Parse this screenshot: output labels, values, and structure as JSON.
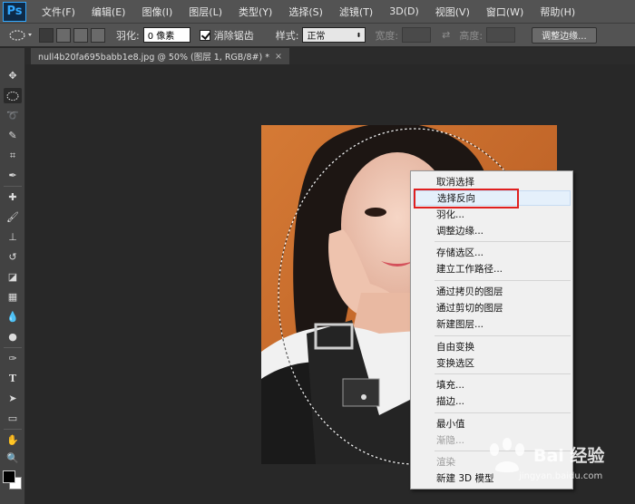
{
  "app": {
    "logo": "Ps"
  },
  "menu": [
    "文件(F)",
    "编辑(E)",
    "图像(I)",
    "图层(L)",
    "类型(Y)",
    "选择(S)",
    "滤镜(T)",
    "3D(D)",
    "视图(V)",
    "窗口(W)",
    "帮助(H)"
  ],
  "options": {
    "feather_label": "羽化:",
    "feather_value": "0 像素",
    "antialias_label": "消除锯齿",
    "style_label": "样式:",
    "style_value": "正常",
    "width_label": "宽度:",
    "height_label": "高度:",
    "refine_button": "调整边缘..."
  },
  "document_tab": {
    "title": "null4b20fa695babb1e8.jpg @ 50% (图层 1, RGB/8#) *",
    "close": "×"
  },
  "tools": [
    "move-tool",
    "elliptical-marquee-tool",
    "lasso-tool",
    "quick-selection-tool",
    "crop-tool",
    "eyedropper-tool",
    "healing-brush-tool",
    "brush-tool",
    "clone-stamp-tool",
    "history-brush-tool",
    "eraser-tool",
    "gradient-tool",
    "blur-tool",
    "dodge-tool",
    "pen-tool",
    "type-tool",
    "path-selection-tool",
    "rectangle-tool",
    "hand-tool",
    "zoom-tool"
  ],
  "context_menu": {
    "items": [
      {
        "label": "取消选择",
        "disabled": false
      },
      {
        "label": "选择反向",
        "disabled": false,
        "hover": true
      },
      {
        "label": "羽化...",
        "disabled": false
      },
      {
        "label": "调整边缘...",
        "disabled": false
      },
      {
        "label": "存储选区...",
        "disabled": false
      },
      {
        "label": "建立工作路径...",
        "disabled": false
      },
      {
        "label": "通过拷贝的图层",
        "disabled": false
      },
      {
        "label": "通过剪切的图层",
        "disabled": false
      },
      {
        "label": "新建图层...",
        "disabled": false
      },
      {
        "label": "自由变换",
        "disabled": false
      },
      {
        "label": "变换选区",
        "disabled": false
      },
      {
        "label": "填充...",
        "disabled": false
      },
      {
        "label": "描边...",
        "disabled": false
      },
      {
        "label": "最小值",
        "disabled": false
      },
      {
        "label": "渐隐...",
        "disabled": true
      },
      {
        "label": "渲染",
        "disabled": true
      },
      {
        "label": "新建 3D 模型",
        "disabled": false
      }
    ]
  },
  "watermark": {
    "text": "Bai 经验",
    "url": "jingyan.baidu.com"
  },
  "colors": {
    "accent_highlight": "#e02020",
    "photo_background": "#c9692a",
    "ui_dark": "#282828"
  }
}
